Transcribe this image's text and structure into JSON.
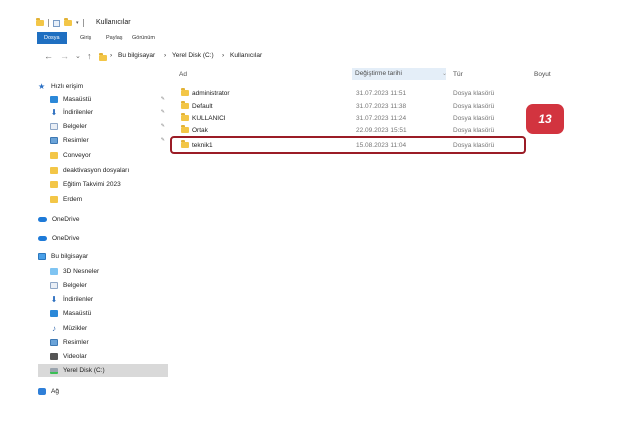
{
  "window": {
    "title": "Kullanıcılar"
  },
  "ribbon": {
    "tabs": [
      {
        "label": "Dosya",
        "active": true
      },
      {
        "label": "Giriş",
        "active": false
      },
      {
        "label": "Paylaş",
        "active": false
      },
      {
        "label": "Görünüm",
        "active": false
      }
    ]
  },
  "address": {
    "back": "←",
    "forward": "→",
    "dropdown": "⌄",
    "up": "↑",
    "crumbs": [
      "Bu bilgisayar",
      "Yerel Disk (C:)",
      "Kullanıcılar"
    ],
    "sep": "›"
  },
  "sidebar": {
    "quick_access": "Hızlı erişim",
    "pinned": [
      {
        "label": "Masaüstü",
        "icon": "desktop-icon"
      },
      {
        "label": "İndirilenler",
        "icon": "download-icon"
      },
      {
        "label": "Belgeler",
        "icon": "documents-icon"
      },
      {
        "label": "Resimler",
        "icon": "pictures-icon"
      }
    ],
    "folders": [
      {
        "label": "Conveyor"
      },
      {
        "label": "deaktivasyon dosyaları"
      },
      {
        "label": "Eğitim Takvimi 2023"
      },
      {
        "label": "Erdem"
      }
    ],
    "onedrive_1": "OneDrive",
    "onedrive_2": "OneDrive",
    "this_pc": "Bu bilgisayar",
    "pc_items": [
      {
        "label": "3D Nesneler",
        "icon": "3d-objects-icon"
      },
      {
        "label": "Belgeler",
        "icon": "documents-icon"
      },
      {
        "label": "İndirilenler",
        "icon": "download-icon"
      },
      {
        "label": "Masaüstü",
        "icon": "desktop-icon"
      },
      {
        "label": "Müzikler",
        "icon": "music-icon"
      },
      {
        "label": "Resimler",
        "icon": "pictures-icon"
      },
      {
        "label": "Videolar",
        "icon": "videos-icon"
      },
      {
        "label": "Yerel Disk (C:)",
        "icon": "disk-icon",
        "selected": true
      }
    ],
    "network": "Ağ"
  },
  "columns": {
    "name": "Ad",
    "date": "Değiştirme tarihi",
    "type": "Tür",
    "size": "Boyut"
  },
  "files": [
    {
      "name": "administrator",
      "date": "31.07.2023 11:51",
      "type": "Dosya klasörü"
    },
    {
      "name": "Default",
      "date": "31.07.2023 11:38",
      "type": "Dosya klasörü"
    },
    {
      "name": "KULLANICI",
      "date": "31.07.2023 11:24",
      "type": "Dosya klasörü"
    },
    {
      "name": "Ortak",
      "date": "22.09.2023 15:51",
      "type": "Dosya klasörü"
    },
    {
      "name": "teknik1",
      "date": "15.08.2023 11:04",
      "type": "Dosya klasörü"
    }
  ],
  "annotation": {
    "step_number": "13"
  },
  "colors": {
    "accent": "#1f6fc1",
    "highlight_border": "#9b1c26",
    "badge": "#d2343f",
    "folder": "#f3c647"
  }
}
